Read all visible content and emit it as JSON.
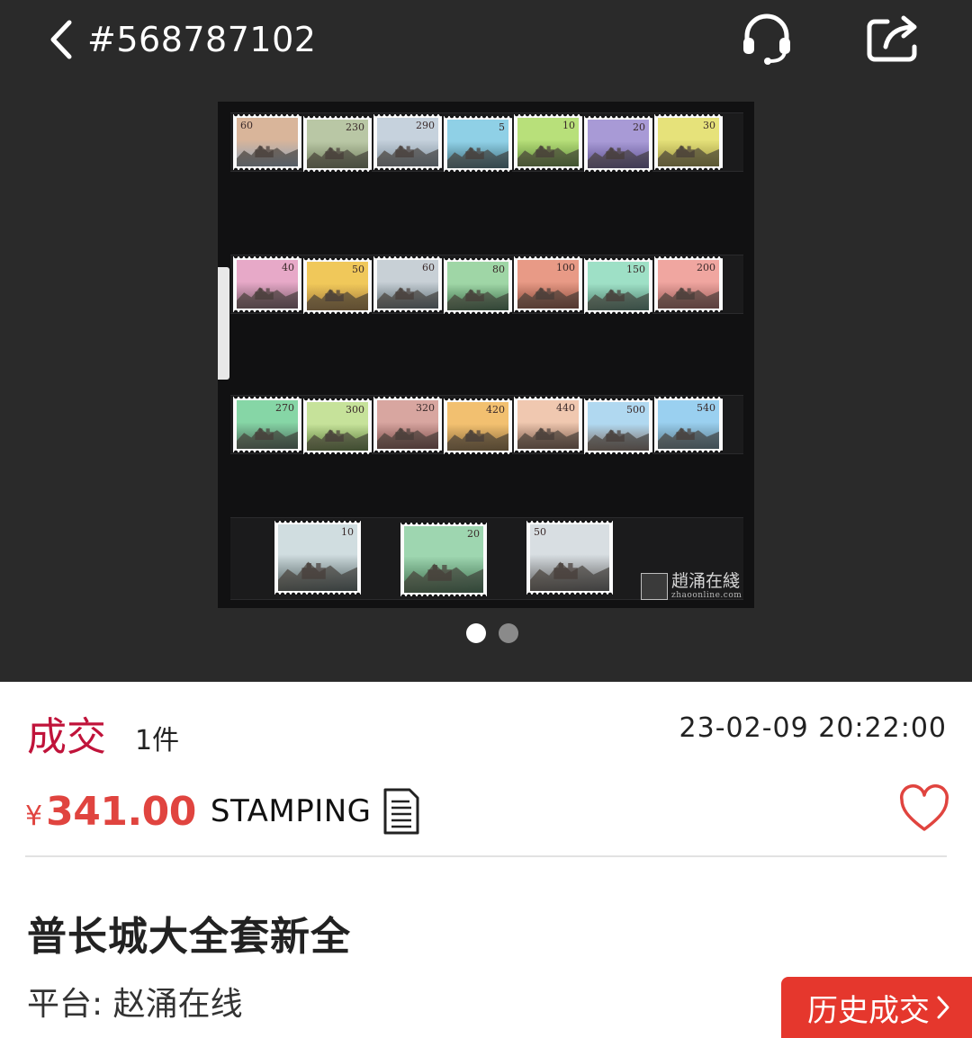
{
  "header": {
    "title": "#568787102",
    "back_icon": "chevron-left-icon",
    "support_icon": "headset-icon",
    "share_icon": "share-icon"
  },
  "gallery": {
    "image_description": "Great Wall definitive stamp set on black stock page",
    "watermark_cn": "趙涌在綫",
    "watermark_en": "zhaoonline.com",
    "stamps_row1": [
      "60",
      "230",
      "290",
      "5",
      "10",
      "20",
      "30"
    ],
    "stamps_row2": [
      "40",
      "50",
      "60",
      "80",
      "100",
      "150",
      "200"
    ],
    "stamps_row3": [
      "270",
      "300",
      "320",
      "420",
      "440",
      "500",
      "540"
    ],
    "stamps_row4": [
      "10",
      "20",
      "50"
    ],
    "pages": 2,
    "current_page": 1
  },
  "deal": {
    "status": "成交",
    "quantity": "1件",
    "time": "23-02-09 20:22:00",
    "currency": "¥",
    "price": "341.00",
    "source_tag": "STAMPING",
    "doc_icon": "document-icon",
    "favorite_icon": "heart-icon"
  },
  "item": {
    "title": "普长城大全套新全",
    "platform": "平台: 赵涌在线"
  },
  "actions": {
    "history_label": "历史成交",
    "history_icon": "chevron-right-icon"
  },
  "colors": {
    "header_bg": "#2a2a2a",
    "status_red": "#c0133a",
    "price_red": "#e0443f",
    "button_red": "#e5372d"
  }
}
